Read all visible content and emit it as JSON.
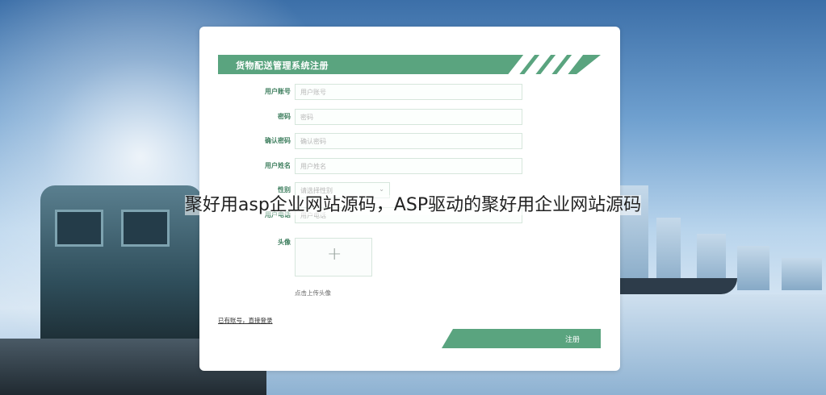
{
  "form": {
    "title": "货物配送管理系统注册",
    "fields": [
      {
        "label": "用户账号",
        "placeholder": "用户账号"
      },
      {
        "label": "密码",
        "placeholder": "密码"
      },
      {
        "label": "确认密码",
        "placeholder": "确认密码"
      },
      {
        "label": "用户姓名",
        "placeholder": "用户姓名"
      },
      {
        "label": "性别",
        "placeholder": "请选择性别"
      },
      {
        "label": "用户电话",
        "placeholder": "用户电话"
      }
    ],
    "avatar_label": "头像",
    "upload_hint": "点击上传头像",
    "login_link": "已有账号，直接登录",
    "register_button": "注册"
  },
  "overlay": {
    "caption": "聚好用asp企业网站源码，ASP驱动的聚好用企业网站源码"
  },
  "colors": {
    "accent": "#5aa47f",
    "label": "#3f7f5f"
  }
}
